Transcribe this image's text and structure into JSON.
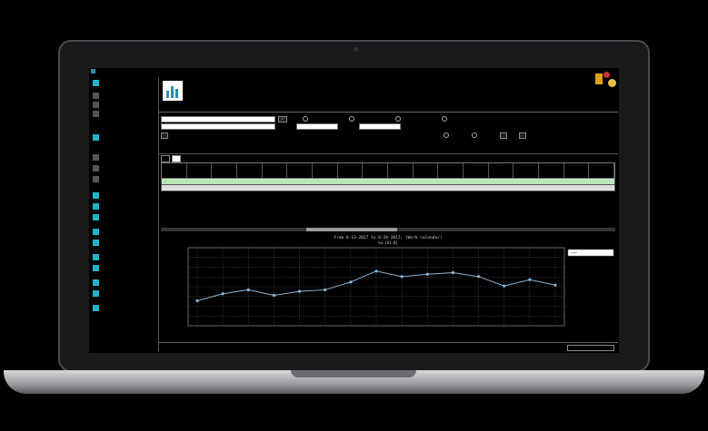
{
  "window": {
    "title": "",
    "header_title": ""
  },
  "sidebar": {
    "items": [
      "",
      "",
      "",
      "",
      "",
      "",
      "",
      "",
      "",
      "",
      "",
      "",
      "",
      "",
      "",
      "",
      "",
      ""
    ]
  },
  "form": {
    "date_from": "",
    "date_to": "",
    "radios": [
      "",
      "",
      "",
      "",
      "",
      ""
    ],
    "buttons": [
      "",
      "",
      ""
    ]
  },
  "tabs": [
    "",
    ""
  ],
  "chart_data": {
    "type": "line",
    "title": "From 8-13-2017 to 8-28-2017, (Work calendar)",
    "subtitle": "%u (U1.0)",
    "legend_position": "top-right",
    "grid": true,
    "y_tick_count": 8,
    "series": [
      {
        "name": "",
        "color": "#8ab4d8",
        "values": [
          0.32,
          0.41,
          0.46,
          0.39,
          0.44,
          0.46,
          0.56,
          0.7,
          0.63,
          0.66,
          0.68,
          0.63,
          0.51,
          0.59,
          0.52
        ]
      }
    ],
    "ylim": [
      0,
      1
    ]
  },
  "colors": {
    "accent": "#1fb5c8",
    "table_green": "#b8e6b8",
    "line": "#8ab4d8"
  }
}
